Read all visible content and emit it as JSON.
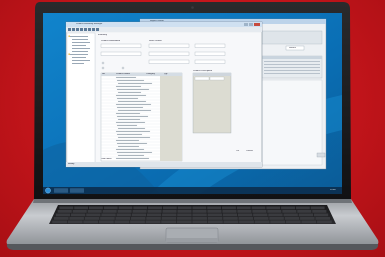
{
  "desktop": {
    "wallpaper_colors": [
      "#0b6fb3",
      "#0f88d1",
      "#1f9ee0"
    ]
  },
  "app": {
    "title": "Product Inventory Manager",
    "main_tab_label": "Inventory",
    "panel_headers": [
      "Product Information",
      "Stock Details",
      "Product Description"
    ],
    "table_headers": [
      "No",
      "Product Name",
      "Category",
      "Qty"
    ],
    "row_count_label": "Total Items",
    "status_text": "Ready",
    "ok_label": "OK",
    "cancel_label": "Cancel"
  },
  "second_window": {
    "title": "Report Viewer",
    "search_label": "Search"
  },
  "taskbar": {
    "clock": "12:00"
  },
  "icons": [
    "start-orb-icon",
    "folder-icon",
    "close-icon",
    "minimize-icon",
    "maximize-icon"
  ]
}
